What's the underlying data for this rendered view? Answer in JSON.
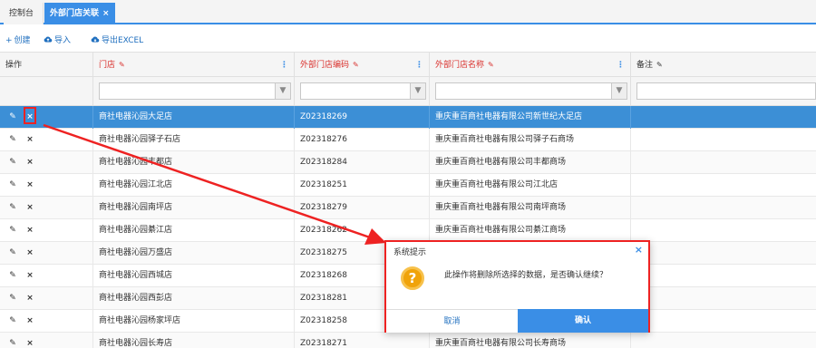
{
  "tabs": [
    {
      "label": "控制台"
    },
    {
      "label": "外部门店关联",
      "close": "×"
    }
  ],
  "toolbar": {
    "create_label": "创建",
    "create_icon": "+",
    "import_label": "导入",
    "export_label": "导出EXCEL"
  },
  "columns": {
    "op": "操作",
    "store": "门店",
    "ext_code": "外部门店编码",
    "ext_name": "外部门店名称",
    "remark": "备注"
  },
  "rows": [
    {
      "store": "商社电器沁园大足店",
      "code": "Z02318269",
      "name": "重庆重百商社电器有限公司新世纪大足店",
      "selected": true
    },
    {
      "store": "商社电器沁园驿子石店",
      "code": "Z02318276",
      "name": "重庆重百商社电器有限公司驿子石商场"
    },
    {
      "store": "商社电器沁园丰都店",
      "code": "Z02318284",
      "name": "重庆重百商社电器有限公司丰都商场"
    },
    {
      "store": "商社电器沁园江北店",
      "code": "Z02318251",
      "name": "重庆重百商社电器有限公司江北店"
    },
    {
      "store": "商社电器沁园南坪店",
      "code": "Z02318279",
      "name": "重庆重百商社电器有限公司南坪商场"
    },
    {
      "store": "商社电器沁园綦江店",
      "code": "Z02318262",
      "name": "重庆重百商社电器有限公司綦江商场"
    },
    {
      "store": "商社电器沁园万盛店",
      "code": "Z02318275",
      "name": ""
    },
    {
      "store": "商社电器沁园西城店",
      "code": "Z02318268",
      "name": ""
    },
    {
      "store": "商社电器沁园西彭店",
      "code": "Z02318281",
      "name": ""
    },
    {
      "store": "商社电器沁园杨家坪店",
      "code": "Z02318258",
      "name": ""
    },
    {
      "store": "商社电器沁园长寿店",
      "code": "Z02318271",
      "name": "重庆重百商社电器有限公司长寿商场"
    }
  ],
  "dialog": {
    "title": "系统提示",
    "close": "×",
    "icon": "?",
    "message": "此操作将删除所选择的数据，是否确认继续？",
    "cancel_label": "取消",
    "confirm_label": "确认"
  },
  "colors": {
    "accent": "#3a8ee6",
    "selected_row": "#3c8fd6",
    "highlight": "#e22222",
    "warning_icon": "#f0a30a"
  }
}
